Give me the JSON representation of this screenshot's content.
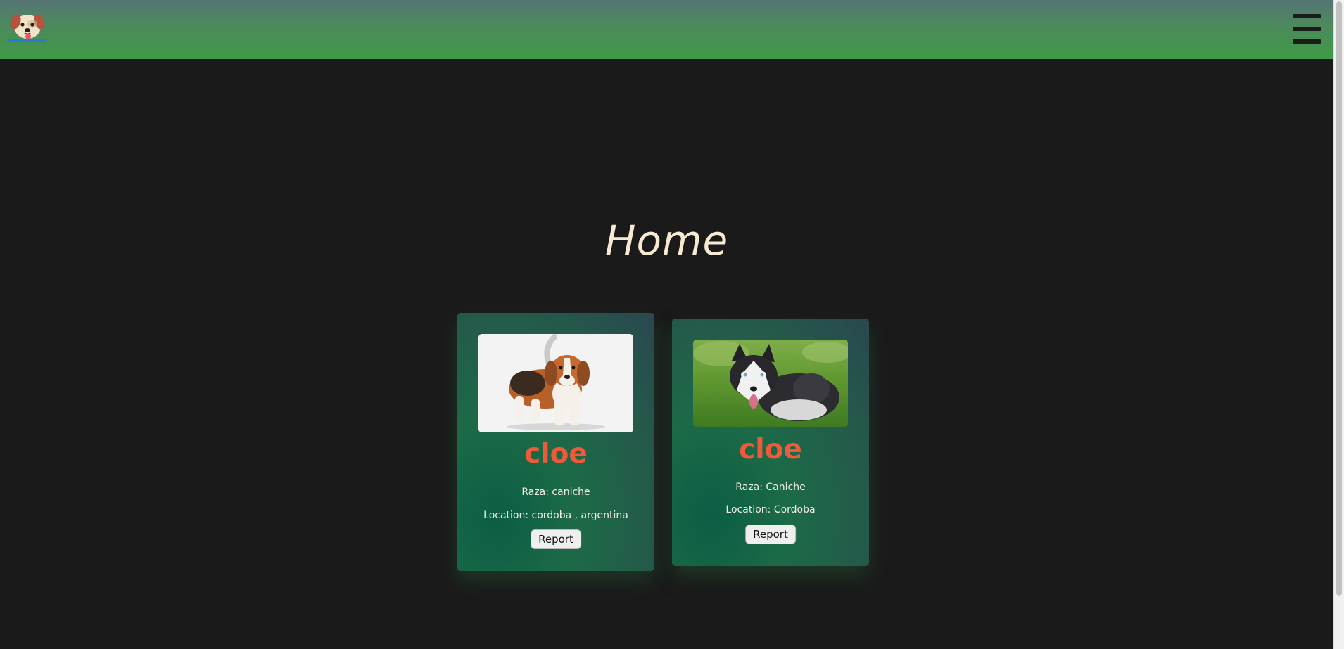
{
  "header": {
    "logo_icon": "dog-face-icon",
    "menu_icon": "hamburger-menu-icon",
    "gradient_top": "#557575",
    "gradient_bottom": "#3e9a45"
  },
  "page": {
    "title": "Home",
    "background": "#1a1a1a"
  },
  "cards": [
    {
      "name": "cloe",
      "raza": "Raza: caniche",
      "location": "Location: cordoba , argentina",
      "report_label": "Report",
      "photo": "beagle-puppy-photo"
    },
    {
      "name": "cloe",
      "raza": "Raza: Caniche",
      "location": "Location: Cordoba",
      "report_label": "Report",
      "photo": "husky-photo"
    }
  ],
  "colors": {
    "name_accent": "#ef5a3b",
    "title_color": "#f7ead2"
  }
}
